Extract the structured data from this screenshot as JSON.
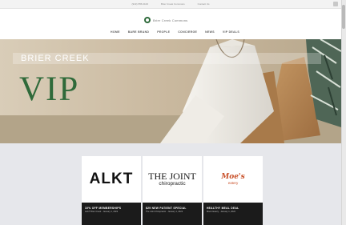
{
  "topbar": {
    "links": [
      "(919) 555-0100",
      "Brier Creek Commons",
      "Contact Us"
    ]
  },
  "header": {
    "logo_text": "Brier Creek Commons",
    "nav": [
      "HOME",
      "BARE BRAND",
      "PEOPLE",
      "CONCIERGE",
      "NEWS",
      "VIP DEALS"
    ]
  },
  "hero": {
    "subtitle": "BRIER CREEK",
    "title": "VIP"
  },
  "cards": [
    {
      "logo": "ALKT",
      "caption": "10% OFF MEMBERSHIPS",
      "subtitle": "ALKT Brier Creek · January 1, 2022"
    },
    {
      "logo_top": "THE JOINT",
      "logo_sub": "chiropractic",
      "caption": "$29 NEW PATIENT SPECIAL",
      "subtitle": "The Joint Chiropractic · January 1, 2022"
    },
    {
      "logo_top": "Moe's",
      "logo_sub": "eatery",
      "caption": "HEALTHY MEAL DEAL",
      "subtitle": "Moe's Eatery · January 1, 2022"
    }
  ],
  "colors": {
    "brand_green": "#2f6a3a",
    "card_band": "#1b1b1b",
    "band_bg": "#e6e7eb"
  }
}
